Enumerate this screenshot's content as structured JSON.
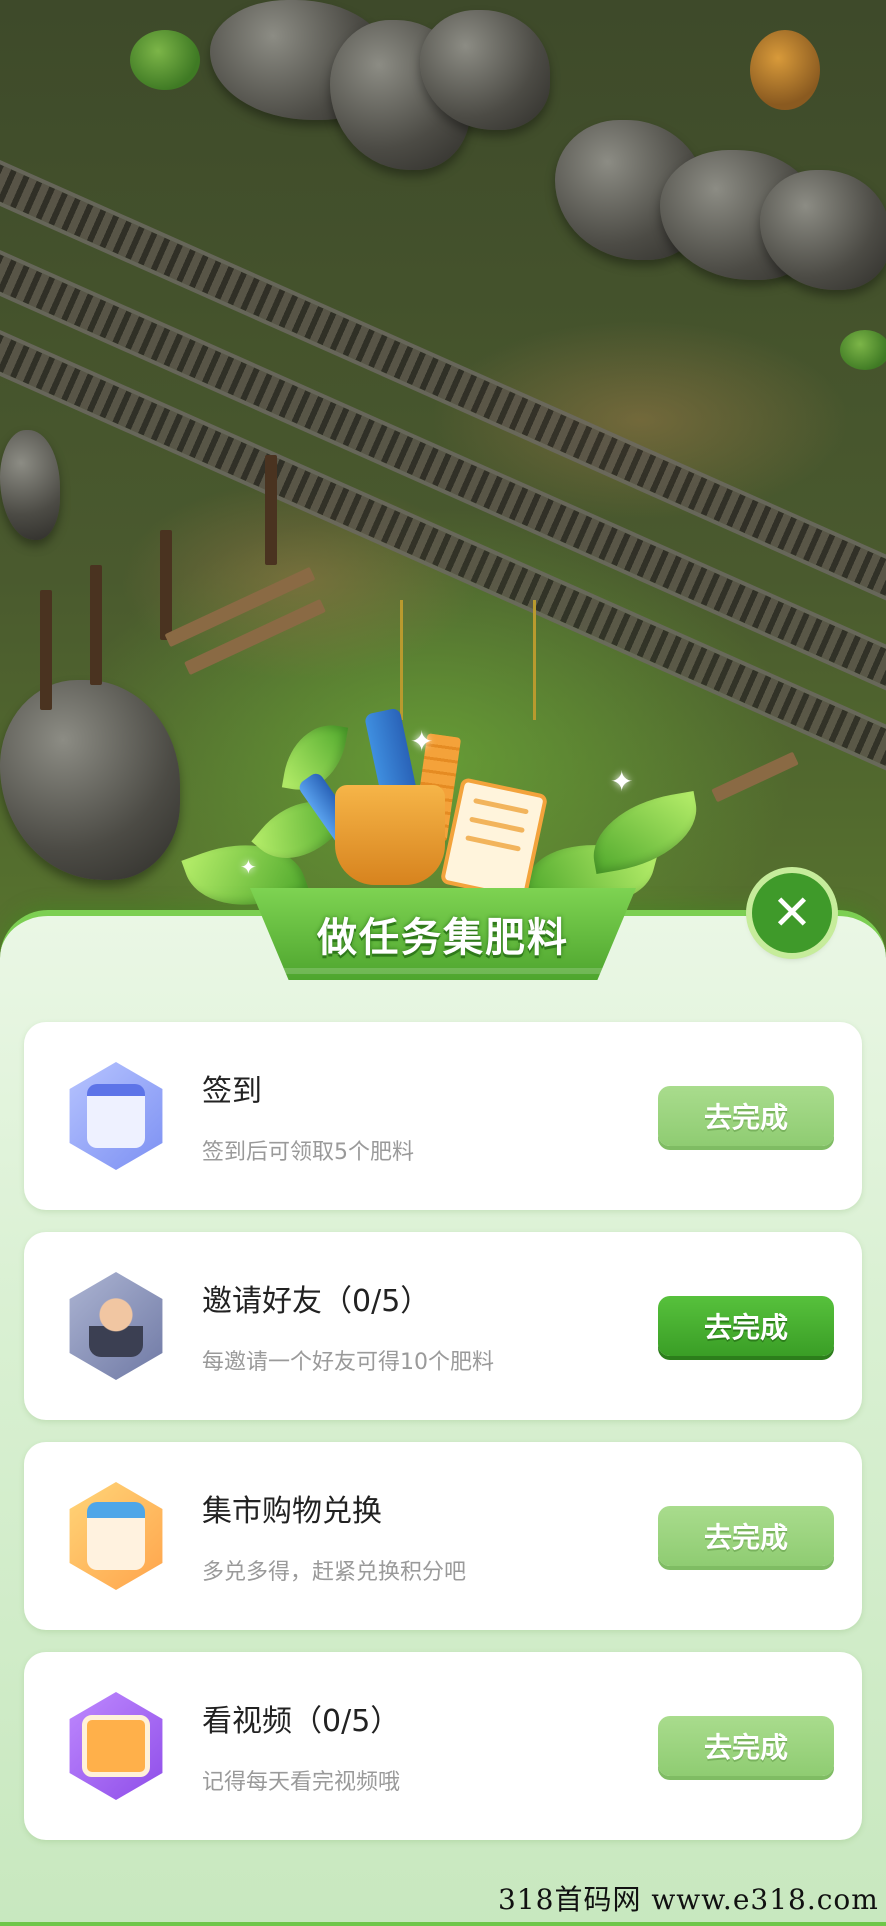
{
  "header": {
    "title": "做任务集肥料",
    "close_icon": "close-icon"
  },
  "tasks": [
    {
      "title": "签到",
      "description": "签到后可领取5个肥料",
      "button": "去完成",
      "icon": "calendar-icon",
      "button_state": "faded"
    },
    {
      "title": "邀请好友（0/5）",
      "description": "每邀请一个好友可得10个肥料",
      "button": "去完成",
      "icon": "user-avatar-icon",
      "button_state": "active"
    },
    {
      "title": "集市购物兑换",
      "description": "多兑多得，赶紧兑换积分吧",
      "button": "去完成",
      "icon": "shop-stall-icon",
      "button_state": "faded"
    },
    {
      "title": "看视频（0/5）",
      "description": "记得每天看完视频哦",
      "button": "去完成",
      "icon": "tv-icon",
      "button_state": "faded"
    }
  ],
  "colors": {
    "active_button": "#3a9e26",
    "faded_button": "#a9dc8d",
    "panel_bg": "#eaf7e5"
  },
  "watermark": "318首码网  www.e318.com"
}
